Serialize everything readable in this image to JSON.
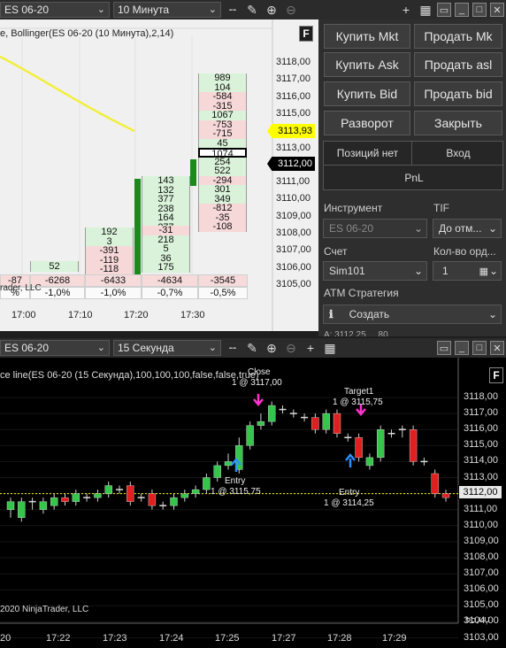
{
  "top_toolbar": {
    "instrument": "ES 06-20",
    "interval": "10 Минута"
  },
  "chart1": {
    "title": "e, Bollinger(ES 06-20 (10 Минута),2,14)",
    "f_label": "F",
    "price_labels": [
      "3118,00",
      "3117,00",
      "3116,00",
      "3115,00",
      "3114,00",
      "3113,00",
      "3112,00",
      "3111,00",
      "3110,00",
      "3109,00",
      "3108,00",
      "3107,00",
      "3106,00",
      "3105,00"
    ],
    "highlight_price": "3113,93",
    "current_price": "3112,00",
    "ladder": [
      "989",
      "104",
      "-584",
      "-315",
      "1067",
      "-753",
      "-715",
      "45",
      "1074",
      "254",
      "522",
      "-294",
      "301",
      "349",
      "-812",
      "-35",
      "-108"
    ],
    "col2": [
      "143",
      "132",
      "377",
      "238",
      "164",
      "277"
    ],
    "col3": [
      "-31",
      "218",
      "5",
      "36",
      "175"
    ],
    "col4": [
      "192",
      "3",
      "-391",
      "-119",
      "-118",
      "-145"
    ],
    "col5": [
      "52"
    ],
    "footer_values": [
      "-87",
      "-6268",
      "-6433",
      "-4634",
      "-3545"
    ],
    "footer_pcts": [
      "%",
      "-1,0%",
      "-1,0%",
      "-0,7%",
      "-0,5%"
    ],
    "copyright": "rader, LLC",
    "time_labels": [
      "17:00",
      "17:10",
      "17:20",
      "17:30"
    ]
  },
  "order_panel": {
    "buy_mkt": "Купить Mkt",
    "sell_mkt": "Продать Mk",
    "buy_ask": "Купить Ask",
    "sell_ask": "Продать asl",
    "buy_bid": "Купить Bid",
    "sell_bid": "Продать bid",
    "reverse": "Разворот",
    "close": "Закрыть",
    "position": "Позиций нет",
    "entry": "Вход",
    "pnl": "PnL",
    "instrument_label": "Инструмент",
    "instrument_value": "ES 06-20",
    "tif_label": "TIF",
    "tif_value": "До отм...",
    "account_label": "Счет",
    "account_value": "Sim101",
    "qty_label": "Кол-во орд...",
    "qty_value": "1",
    "atm_label": "ATM Стратегия",
    "atm_value": "Создать",
    "cut_text": "А: 3112,25 ... 80"
  },
  "bottom_toolbar": {
    "instrument": "ES 06-20",
    "interval": "15 Секунда"
  },
  "chart2": {
    "title": "ce line(ES 06-20 (15 Секунда),100,100,100,false,false,true)",
    "price_labels": [
      "3118,00",
      "3117,00",
      "3116,00",
      "3115,00",
      "3114,00",
      "3113,00",
      "3112,00",
      "3111,00",
      "3110,00",
      "3109,00",
      "3108,00",
      "3107,00",
      "3106,00",
      "3105,00",
      "3104,00",
      "3103,00"
    ],
    "current_price": "3112,00",
    "cut_price": "55,00",
    "time_labels": [
      "20",
      "17:22",
      "17:23",
      "17:24",
      "17:25",
      "17:27",
      "17:28",
      "17:29"
    ],
    "copyright": "2020 NinjaTrader, LLC",
    "annotations": {
      "close_title": "Close",
      "close_detail": "1 @ 3117,00",
      "target_title": "Target1",
      "target_detail": "1 @ 3115,75",
      "entry1_title": "Entry",
      "entry1_detail": "1 @ 3115,75",
      "entry2_title": "Entry",
      "entry2_detail": "1 @ 3114,25"
    }
  },
  "colors": {
    "bull": "#35c54a",
    "bear": "#e02020",
    "yellow": "#ffff00",
    "magenta": "#ff33cc",
    "blue": "#2e8fff"
  }
}
